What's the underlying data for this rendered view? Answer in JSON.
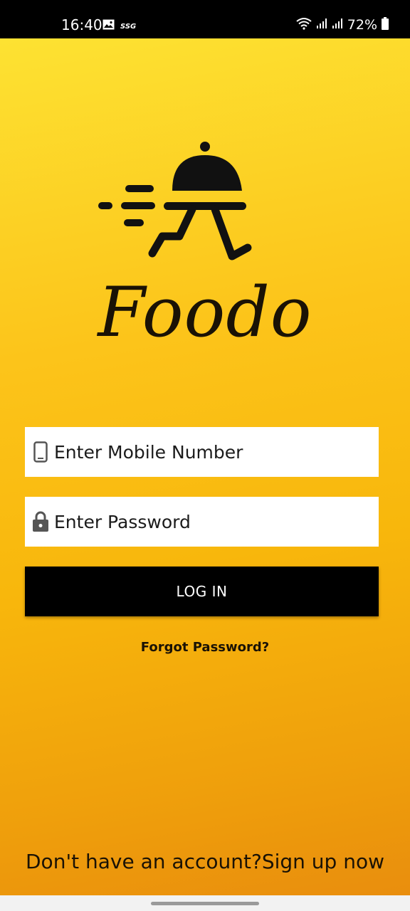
{
  "status_bar": {
    "time": "16:40",
    "left_icons": [
      "gallery-icon",
      "ssg-icon"
    ],
    "ssg_text": "SSG",
    "right_icons": [
      "wifi-icon",
      "signal-icon",
      "signal-icon",
      "battery-icon"
    ],
    "battery_percent": "72%"
  },
  "brand": {
    "name": "Foodo",
    "logo_icon": "delivery-cloche-icon"
  },
  "form": {
    "mobile_placeholder": "Enter Mobile Number",
    "mobile_icon": "phone-icon",
    "password_placeholder": "Enter Password",
    "password_icon": "lock-icon",
    "login_label": "LOG IN",
    "forgot_label": "Forgot Password?"
  },
  "footer": {
    "signup_text": "Don't have an account?Sign up now"
  },
  "colors": {
    "background_top": "#fde232",
    "background_bottom": "#e98e0d",
    "button": "#000000",
    "input_bg": "#ffffff"
  }
}
